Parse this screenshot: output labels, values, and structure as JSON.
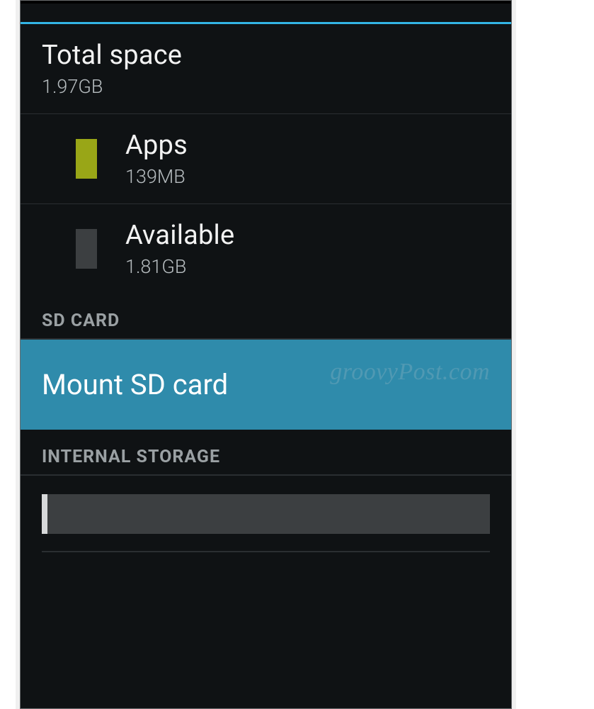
{
  "storage": {
    "total": {
      "label": "Total space",
      "value": "1.97GB"
    },
    "apps": {
      "label": "Apps",
      "value": "139MB",
      "swatch": "#99a617"
    },
    "avail": {
      "label": "Available",
      "value": "1.81GB",
      "swatch": "#3c3f41"
    }
  },
  "sections": {
    "sd": "SD CARD",
    "internal": "INTERNAL STORAGE"
  },
  "actions": {
    "mount": "Mount SD card"
  },
  "watermark": "groovyPost.com"
}
